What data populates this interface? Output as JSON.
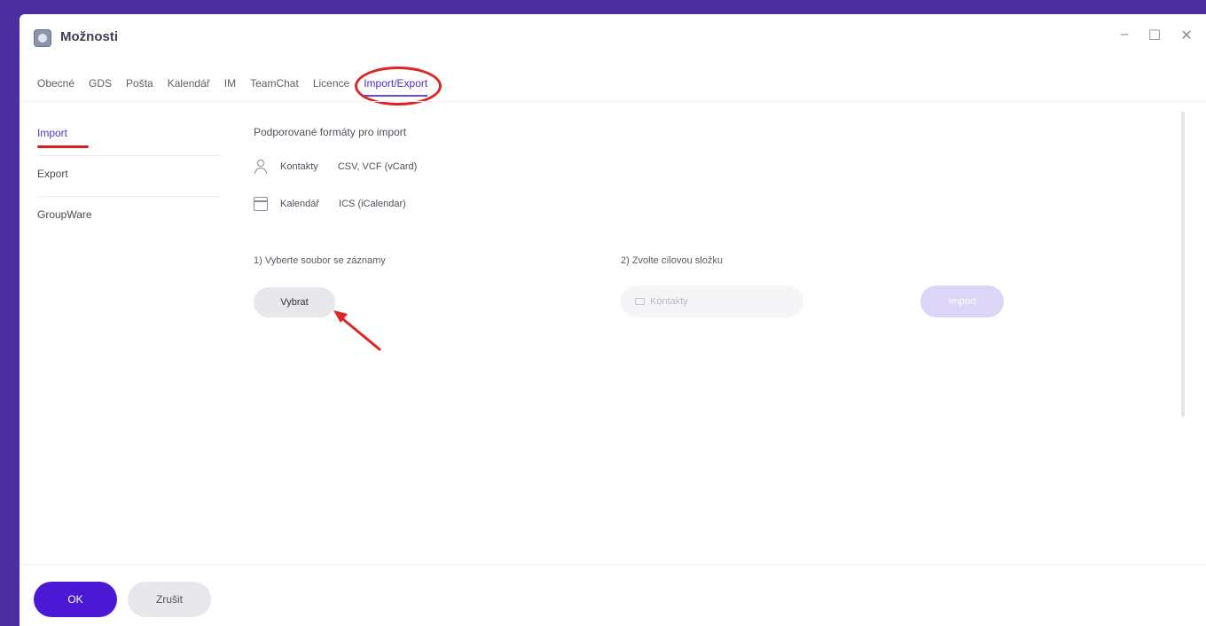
{
  "window": {
    "title": "Možnosti",
    "minimize": "–",
    "maximize": "☐",
    "close": "✕"
  },
  "tabs": [
    {
      "label": "Obecné"
    },
    {
      "label": "GDS"
    },
    {
      "label": "Pošta"
    },
    {
      "label": "Kalendář"
    },
    {
      "label": "IM"
    },
    {
      "label": "TeamChat"
    },
    {
      "label": "Licence"
    },
    {
      "label": "Import/Export",
      "active": true
    }
  ],
  "sidebar": {
    "items": [
      {
        "label": "Import",
        "active": true
      },
      {
        "label": "Export"
      },
      {
        "label": "GroupWare"
      }
    ]
  },
  "content": {
    "heading": "Podporované formáty pro import",
    "formats": [
      {
        "icon": "person-icon",
        "name": "Kontakty",
        "types": "CSV, VCF (vCard)"
      },
      {
        "icon": "calendar-icon",
        "name": "Kalendář",
        "types": "ICS (iCalendar)"
      }
    ],
    "step1_label": "1) Vyberte soubor se záznamy",
    "step1_button": "Vybrat",
    "step2_label": "2) Zvolte cílovou složku",
    "folder_placeholder": "Kontakty",
    "import_button": "Import"
  },
  "footer": {
    "ok_label": "OK",
    "cancel_label": "Zrušit"
  },
  "colors": {
    "accent": "#4b19d6",
    "annotation": "#e02525",
    "background": "#4b2fa0"
  }
}
